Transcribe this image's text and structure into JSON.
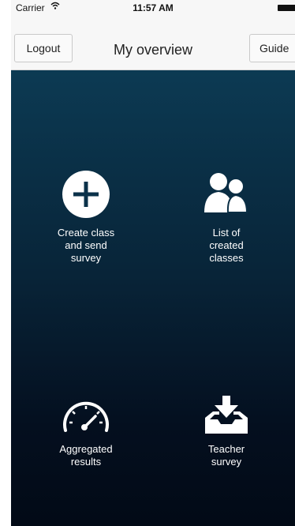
{
  "status_bar": {
    "carrier": "Carrier",
    "time": "11:57 AM"
  },
  "nav": {
    "logout_label": "Logout",
    "title": "My overview",
    "guide_label": "Guide"
  },
  "tiles": [
    {
      "icon": "plus-circle-icon",
      "label_lines": [
        "Create class",
        "and send",
        "survey"
      ]
    },
    {
      "icon": "users-icon",
      "label_lines": [
        "List of",
        "created",
        "classes"
      ]
    },
    {
      "icon": "speedometer-icon",
      "label_lines": [
        "Aggregated",
        "results"
      ]
    },
    {
      "icon": "download-tray-icon",
      "label_lines": [
        "Teacher",
        "survey"
      ]
    }
  ],
  "colors": {
    "nav_background": "#f7f7f7",
    "main_top": "#0c3a53",
    "main_bottom": "#020a16",
    "icon": "#ffffff"
  }
}
